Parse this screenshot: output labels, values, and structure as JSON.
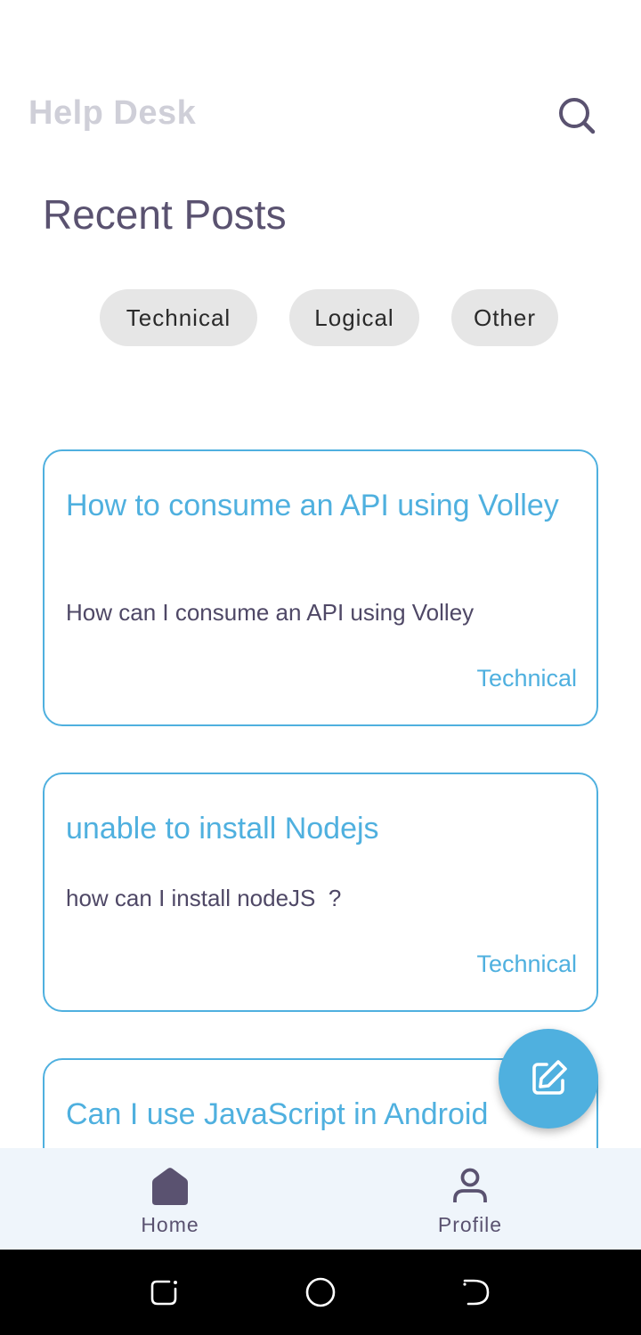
{
  "header": {
    "title": "Help Desk",
    "search_icon": "search-icon"
  },
  "section_title": "Recent Posts",
  "filters": [
    "Technical",
    "Logical",
    "Other"
  ],
  "posts": [
    {
      "title": "How to consume an API using Volley",
      "body": "How can I consume an API using Volley",
      "tag": "Technical"
    },
    {
      "title": "unable to install Nodejs",
      "body": "how can I install nodeJS  ?",
      "tag": "Technical"
    },
    {
      "title": "Can I use JavaScript in Android",
      "body": "",
      "tag": ""
    }
  ],
  "fab": {
    "icon": "edit-icon"
  },
  "bottom_nav": [
    {
      "label": "Home",
      "icon": "home-icon",
      "selected": true
    },
    {
      "label": "Profile",
      "icon": "person-icon",
      "selected": false
    }
  ],
  "system_nav": [
    "recents-icon",
    "home-circle-icon",
    "back-icon"
  ],
  "colors": {
    "accent": "#4fb0df",
    "primary_text": "#5a5270",
    "title_muted": "#cfcfd8",
    "chip_bg": "#e6e6e6",
    "nav_bg": "#eff5fb"
  }
}
